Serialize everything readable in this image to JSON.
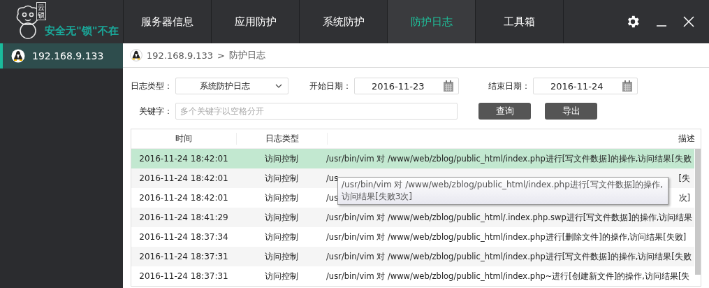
{
  "logo": {
    "stamp": "云锁",
    "slogan": "安全无\"锁\"不在"
  },
  "nav": [
    {
      "label": "服务器信息",
      "selected": false
    },
    {
      "label": "应用防护",
      "selected": false
    },
    {
      "label": "系统防护",
      "selected": false
    },
    {
      "label": "防护日志",
      "selected": true
    },
    {
      "label": "工具箱",
      "selected": false
    }
  ],
  "sidebar": {
    "items": [
      {
        "label": "192.168.9.133",
        "selected": true
      }
    ]
  },
  "breadcrumb": {
    "host": "192.168.9.133",
    "separator": ">",
    "page": "防护日志"
  },
  "filters": {
    "log_type": {
      "label": "日志类型：",
      "value": "系统防护日志"
    },
    "start_date": {
      "label": "开始日期：",
      "value": "2016-11-23"
    },
    "end_date": {
      "label": "结束日期：",
      "value": "2016-11-24"
    },
    "keyword": {
      "label": "关键字：",
      "placeholder": "多个关键字以空格分开"
    },
    "buttons": [
      "查询",
      "导出"
    ]
  },
  "table": {
    "columns": [
      "时间",
      "日志类型",
      "描述"
    ],
    "rows": [
      {
        "time": "2016-11-24 18:42:01",
        "type": "访问控制",
        "desc": "/usr/bin/vim 对 /www/web/zblog/public_html/index.php进行[写文件数据]的操作,访问结果[失败",
        "selected": true
      },
      {
        "time": "2016-11-24 18:42:01",
        "type": "访问控制",
        "desc": "/us",
        "desc_tail": "[失",
        "selected": false
      },
      {
        "time": "2016-11-24 18:42:01",
        "type": "访问控制",
        "desc": "/us",
        "desc_tail": "次]",
        "selected": false
      },
      {
        "time": "2016-11-24 18:41:29",
        "type": "访问控制",
        "desc": "/usr/bin/vim 对 /www/web/zblog/public_html/.index.php.swp进行[写文件数据]的操作,访问结果",
        "selected": false
      },
      {
        "time": "2016-11-24 18:37:34",
        "type": "访问控制",
        "desc": "/usr/bin/vim 对 /www/web/zblog/public_html/index.php进行[删除文件]的操作,访问结果[失败]",
        "selected": false
      },
      {
        "time": "2016-11-24 18:37:31",
        "type": "访问控制",
        "desc": "/usr/bin/vim 对 /www/web/zblog/public_html/index.php进行[写文件数据]的操作,访问结果[失败",
        "selected": false
      },
      {
        "time": "2016-11-24 18:37:31",
        "type": "访问控制",
        "desc": "/usr/bin/vim 对 /www/web/zblog/public_html/index.php~进行[创建新文件]的操作,访问结果[失",
        "selected": false
      }
    ]
  },
  "tooltip": {
    "text": "/usr/bin/vim 对 /www/web/zblog/public_html/index.php进行[写文件数据]的操作,访问结果[失败3次]"
  }
}
